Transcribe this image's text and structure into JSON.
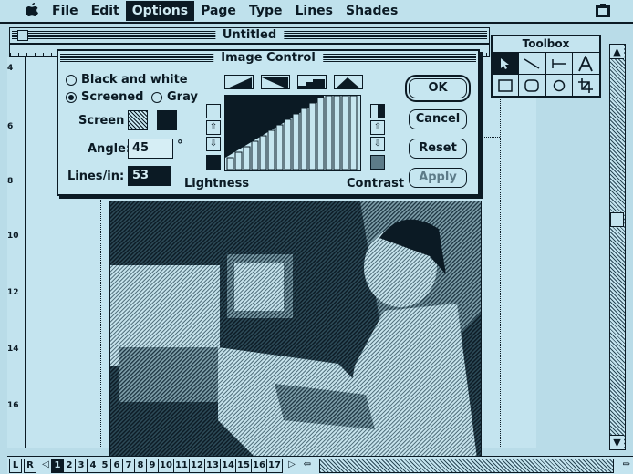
{
  "menubar": {
    "apple_icon": "apple-icon",
    "items": [
      "File",
      "Edit",
      "Options",
      "Page",
      "Type",
      "Lines",
      "Shades"
    ],
    "selected": "Options",
    "clipboard_icon": "clipboard-icon"
  },
  "window": {
    "title": "Untitled"
  },
  "rulers": {
    "vertical_ticks": [
      "4",
      "6",
      "8",
      "10",
      "12",
      "14",
      "16"
    ]
  },
  "toolbox": {
    "title": "Toolbox",
    "tools": [
      "pointer-icon",
      "diagonal-line-icon",
      "orthogonal-line-icon",
      "text-icon",
      "rectangle-icon",
      "rounded-rectangle-icon",
      "oval-icon",
      "crop-icon"
    ],
    "selected": "pointer-icon"
  },
  "dialog": {
    "title": "Image Control",
    "mode_options": [
      {
        "label": "Black and white",
        "selected": false
      },
      {
        "label": "Screened",
        "selected": true
      },
      {
        "label": "Gray",
        "selected": false
      }
    ],
    "screen_label": "Screen",
    "angle_label": "Angle:",
    "angle_value": "45",
    "angle_unit": "°",
    "lines_label": "Lines/in:",
    "lines_value": "53",
    "lightness_label": "Lightness",
    "contrast_label": "Contrast",
    "buttons": {
      "ok": "OK",
      "cancel": "Cancel",
      "reset": "Reset",
      "apply": "Apply"
    },
    "preset_shapes": [
      "normal-ramp-icon",
      "negative-ramp-icon",
      "posterized-icon",
      "solarized-icon"
    ]
  },
  "pagebar": {
    "left_label": "L",
    "right_label": "R",
    "pages": [
      "1",
      "2",
      "3",
      "4",
      "5",
      "6",
      "7",
      "8",
      "9",
      "10",
      "11",
      "12",
      "13",
      "14",
      "15",
      "16",
      "17"
    ],
    "current_page": "1"
  },
  "colors": {
    "background": "#b9dce8",
    "ink": "#0b1a24"
  }
}
